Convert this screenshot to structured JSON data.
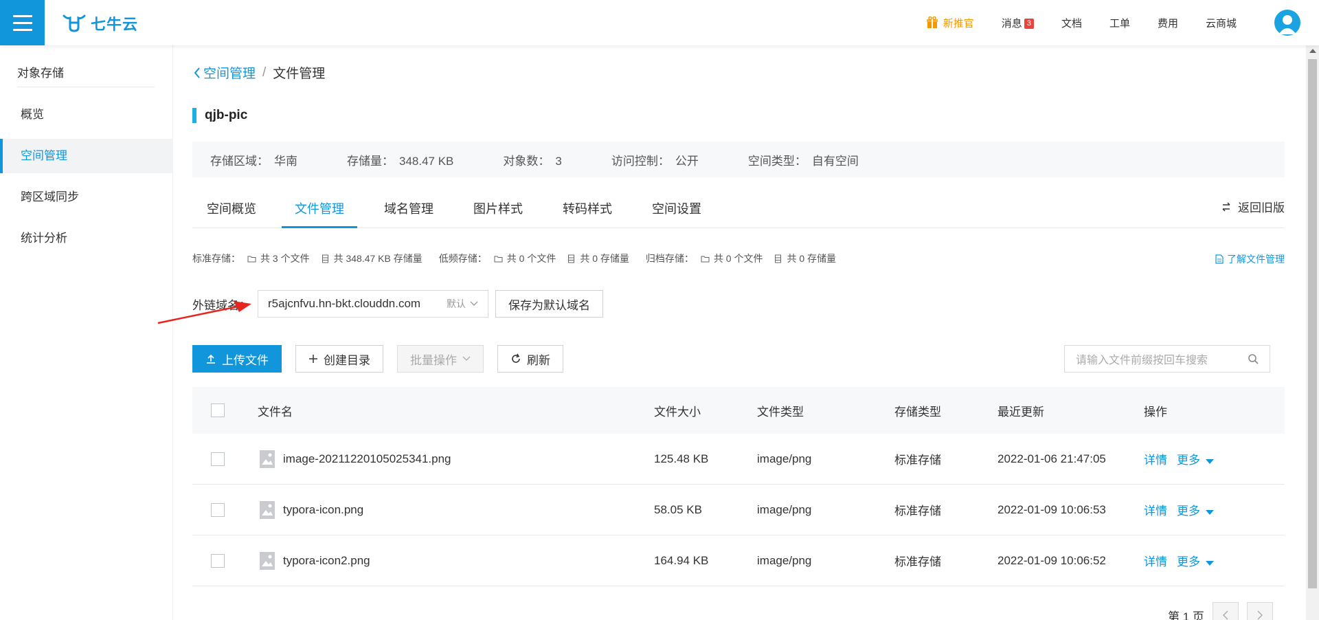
{
  "header": {
    "logo_text": "七牛云",
    "nav": {
      "promo": "新推官",
      "messages": "消息",
      "messages_count": "3",
      "docs": "文档",
      "tickets": "工单",
      "billing": "费用",
      "market": "云商城"
    }
  },
  "sidebar": {
    "title": "对象存储",
    "items": [
      {
        "label": "概览"
      },
      {
        "label": "空间管理"
      },
      {
        "label": "跨区域同步"
      },
      {
        "label": "统计分析"
      }
    ]
  },
  "breadcrumb": {
    "parent": "空间管理",
    "separator": "/",
    "current": "文件管理"
  },
  "bucket": {
    "name": "qjb-pic",
    "stats": [
      {
        "label": "存储区域：",
        "value": "华南"
      },
      {
        "label": "存储量：",
        "value": "348.47 KB"
      },
      {
        "label": "对象数：",
        "value": "3"
      },
      {
        "label": "访问控制：",
        "value": "公开"
      },
      {
        "label": "空间类型：",
        "value": "自有空间"
      }
    ]
  },
  "tabs": [
    "空间概览",
    "文件管理",
    "域名管理",
    "图片样式",
    "转码样式",
    "空间设置"
  ],
  "back_old": "返回旧版",
  "storage_summary": {
    "standard_label": "标准存储：",
    "standard_files": "共 3 个文件",
    "standard_size": "共 348.47 KB 存储量",
    "infrequent_label": "低频存储：",
    "infrequent_files": "共 0 个文件",
    "infrequent_size": "共 0 存储量",
    "archive_label": "归档存储：",
    "archive_files": "共 0 个文件",
    "archive_size": "共 0 存储量"
  },
  "learn_link": "了解文件管理",
  "domain": {
    "label": "外链域名：",
    "value": "r5ajcnfvu.hn-bkt.clouddn.com",
    "default_tag": "默认",
    "save_button": "保存为默认域名"
  },
  "toolbar": {
    "upload": "上传文件",
    "create_dir": "创建目录",
    "batch": "批量操作",
    "refresh": "刷新",
    "search_placeholder": "请输入文件前缀按回车搜索"
  },
  "table": {
    "headers": {
      "name": "文件名",
      "size": "文件大小",
      "type": "文件类型",
      "storage": "存储类型",
      "updated": "最近更新",
      "actions": "操作"
    },
    "rows": [
      {
        "name": "image-20211220105025341.png",
        "size": "125.48 KB",
        "type": "image/png",
        "storage": "标准存储",
        "updated": "2022-01-06 21:47:05"
      },
      {
        "name": "typora-icon.png",
        "size": "58.05 KB",
        "type": "image/png",
        "storage": "标准存储",
        "updated": "2022-01-09 10:06:53"
      },
      {
        "name": "typora-icon2.png",
        "size": "164.94 KB",
        "type": "image/png",
        "storage": "标准存储",
        "updated": "2022-01-09 10:06:52"
      }
    ],
    "action_detail": "详情",
    "action_more": "更多"
  },
  "pagination": {
    "page_text": "第 1 页"
  },
  "colors": {
    "brand": "#1296db",
    "promo": "#f39800",
    "badge": "#e8463c",
    "annotation_arrow": "#e8251d"
  }
}
